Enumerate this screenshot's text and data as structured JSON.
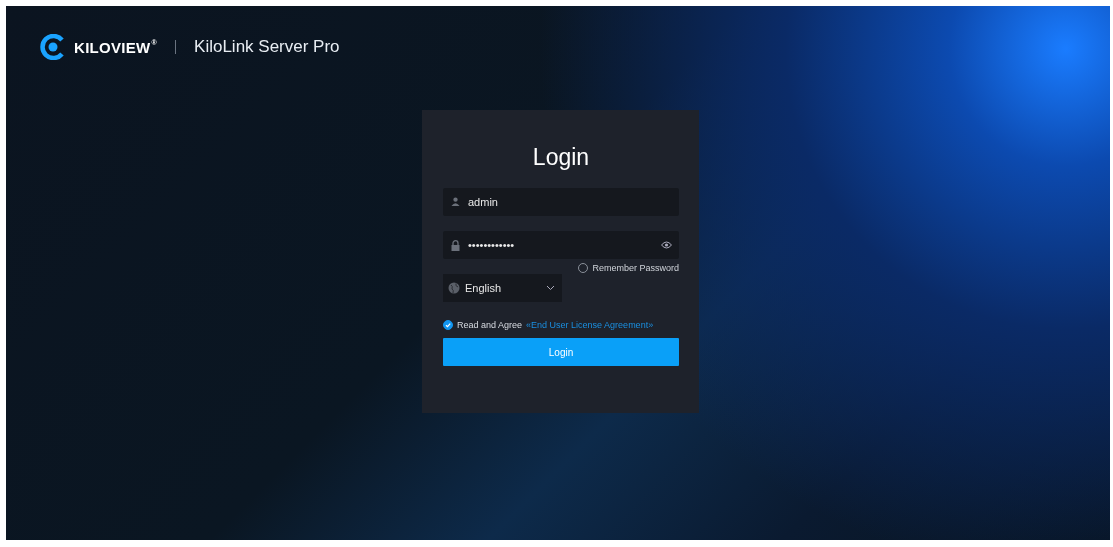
{
  "header": {
    "brand": "KILOVIEW",
    "brand_mark": "®",
    "product": "KiloLink Server Pro"
  },
  "login_form": {
    "title": "Login",
    "username": {
      "value": "admin"
    },
    "password": {
      "value": "••••••••••••"
    },
    "remember_password": {
      "label": "Remember Password",
      "checked": false
    },
    "language": {
      "value": "English"
    },
    "agreement": {
      "label": "Read and Agree",
      "link": "«End User License Agreement»",
      "checked": true
    },
    "submit": "Login"
  }
}
